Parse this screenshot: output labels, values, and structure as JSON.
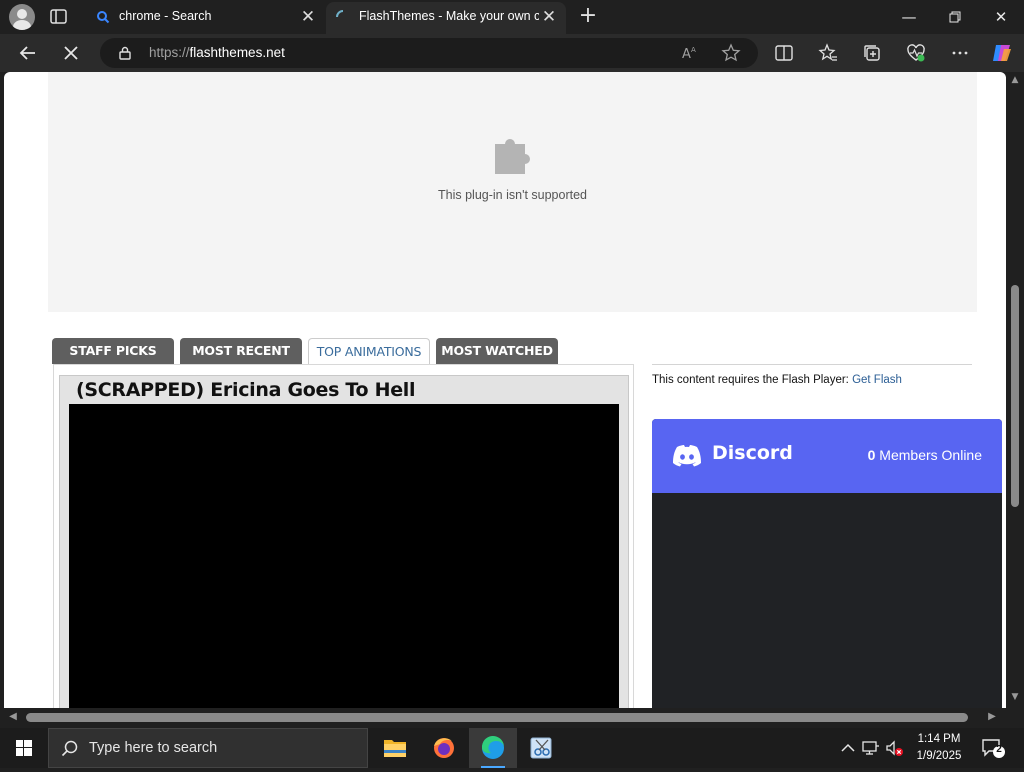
{
  "browser": {
    "tabs": [
      {
        "title": "chrome - Search",
        "icon": "search-favicon"
      },
      {
        "title": "FlashThemes - Make your own ca",
        "icon": "loading-spinner-icon"
      }
    ],
    "address": {
      "protocol": "https://",
      "host": "flashthemes.net"
    }
  },
  "page": {
    "plugin_message": "This plug-in isn't supported",
    "tabs": [
      {
        "label": "STAFF PICKS",
        "active": false
      },
      {
        "label": "MOST RECENT",
        "active": false
      },
      {
        "label": "TOP ANIMATIONS",
        "active": true
      },
      {
        "label": "MOST WATCHED",
        "active": false
      }
    ],
    "animation_title": "(SCRAPPED) Ericina Goes To Hell",
    "flash_note": "This content requires the Flash Player:",
    "flash_link": "Get Flash",
    "discord": {
      "name": "Discord",
      "members_count": "0",
      "members_label": "Members Online",
      "header_color": "#5865f2"
    }
  },
  "taskbar": {
    "search_placeholder": "Type here to search",
    "time": "1:14 PM",
    "date": "1/9/2025",
    "notification_count": "2"
  }
}
